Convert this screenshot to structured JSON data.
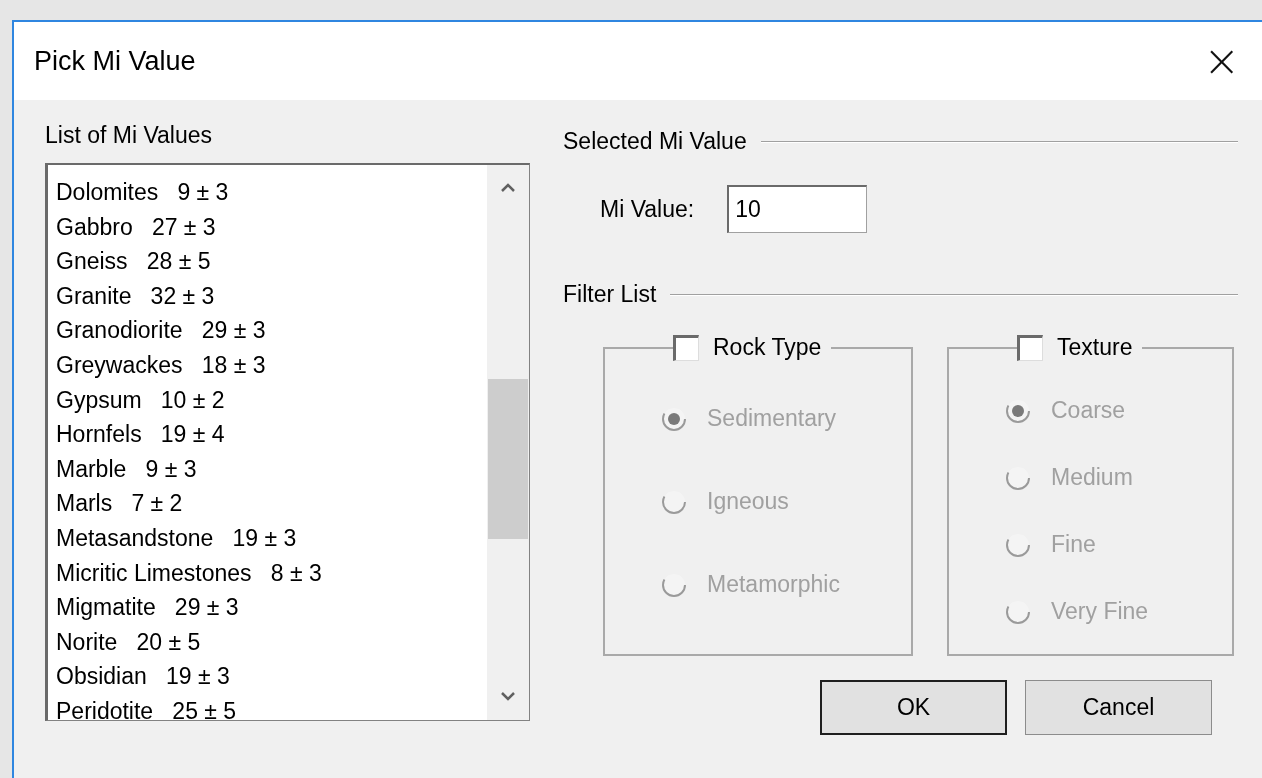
{
  "window": {
    "title": "Pick Mi Value",
    "close": "×"
  },
  "list": {
    "label": "List of Mi Values",
    "items": [
      {
        "text": "Dolomites   9 ± 3"
      },
      {
        "text": "Gabbro   27 ± 3"
      },
      {
        "text": "Gneiss   28 ± 5"
      },
      {
        "text": "Granite   32 ± 3"
      },
      {
        "text": "Granodiorite   29 ± 3"
      },
      {
        "text": "Greywackes   18 ± 3"
      },
      {
        "text": "Gypsum   10 ± 2"
      },
      {
        "text": "Hornfels   19 ± 4"
      },
      {
        "text": "Marble   9 ± 3"
      },
      {
        "text": "Marls   7 ± 2"
      },
      {
        "text": "Metasandstone   19 ± 3"
      },
      {
        "text": "Micritic Limestones   8 ± 3"
      },
      {
        "text": "Migmatite   29 ± 3"
      },
      {
        "text": "Norite   20 ± 5"
      },
      {
        "text": "Obsidian   19 ± 3"
      },
      {
        "text": "Peridotite   25 ± 5"
      }
    ]
  },
  "selected_group": {
    "title": "Selected Mi Value",
    "field_label": "Mi Value:",
    "value": "10"
  },
  "filter_group": {
    "title": "Filter List",
    "groups": [
      {
        "title": "Rock Type",
        "checked": false,
        "options": [
          {
            "label": "Sedimentary",
            "selected": true,
            "disabled": true
          },
          {
            "label": "Igneous",
            "selected": false,
            "disabled": true
          },
          {
            "label": "Metamorphic",
            "selected": false,
            "disabled": true
          }
        ]
      },
      {
        "title": "Texture",
        "checked": false,
        "options": [
          {
            "label": "Coarse",
            "selected": true,
            "disabled": true
          },
          {
            "label": "Medium",
            "selected": false,
            "disabled": true
          },
          {
            "label": "Fine",
            "selected": false,
            "disabled": true
          },
          {
            "label": "Very Fine",
            "selected": false,
            "disabled": true
          }
        ]
      }
    ]
  },
  "buttons": [
    {
      "label": "OK",
      "default": true
    },
    {
      "label": "Cancel",
      "default": false
    }
  ]
}
